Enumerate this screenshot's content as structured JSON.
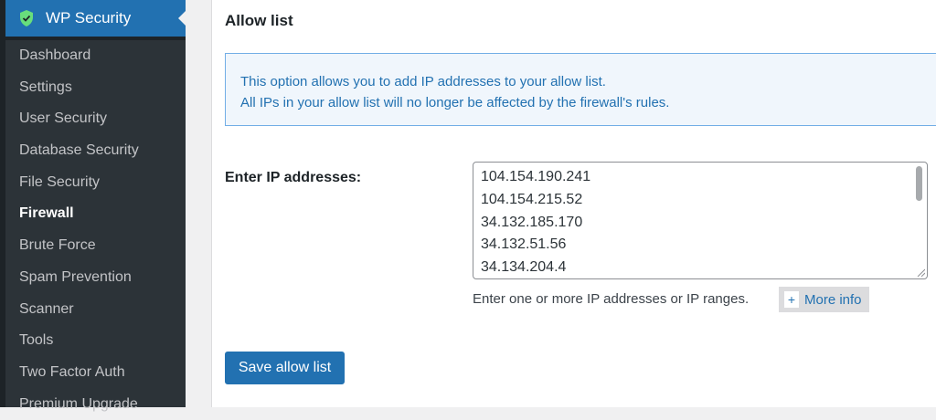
{
  "sidebar": {
    "title": "WP Security",
    "items": [
      {
        "label": "Dashboard",
        "active": false
      },
      {
        "label": "Settings",
        "active": false
      },
      {
        "label": "User Security",
        "active": false
      },
      {
        "label": "Database Security",
        "active": false
      },
      {
        "label": "File Security",
        "active": false
      },
      {
        "label": "Firewall",
        "active": true
      },
      {
        "label": "Brute Force",
        "active": false
      },
      {
        "label": "Spam Prevention",
        "active": false
      },
      {
        "label": "Scanner",
        "active": false
      },
      {
        "label": "Tools",
        "active": false
      },
      {
        "label": "Two Factor Auth",
        "active": false
      },
      {
        "label": "Premium Upgrade",
        "active": false
      }
    ]
  },
  "main": {
    "section_title": "Allow list",
    "info": {
      "line1": "This option allows you to add IP addresses to your allow list.",
      "line2": "All IPs in your allow list will no longer be affected by the firewall's rules."
    },
    "field_label": "Enter IP addresses:",
    "ip_addresses": [
      "104.154.190.241",
      "104.154.215.52",
      "34.132.185.170",
      "34.132.51.56",
      "34.134.204.4"
    ],
    "help_text": "Enter one or more IP addresses or IP ranges.",
    "more_info": {
      "plus": "+",
      "label": "More info"
    },
    "save_label": "Save allow list"
  },
  "colors": {
    "accent": "#2271b1",
    "sidebar_bg": "#1d2327",
    "submenu_bg": "#2c3338",
    "shield": "#68de7c"
  },
  "icons": {
    "header": "shield-check-icon",
    "more_info": "plus-icon"
  }
}
